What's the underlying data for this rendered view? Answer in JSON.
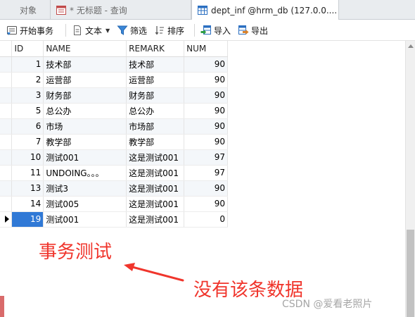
{
  "tabs": [
    {
      "label": "对象",
      "active": false
    },
    {
      "label": "* 无标题 - 查询",
      "active": false
    },
    {
      "label": "dept_inf @hrm_db (127.0.0....",
      "active": true
    }
  ],
  "toolbar": {
    "begin_transaction": "开始事务",
    "text": "文本",
    "filter": "筛选",
    "sort": "排序",
    "import": "导入",
    "export": "导出"
  },
  "table": {
    "columns": [
      "ID",
      "NAME",
      "REMARK",
      "NUM"
    ],
    "rows": [
      {
        "id": "1",
        "name": "技术部",
        "remark": "技术部",
        "num": "90"
      },
      {
        "id": "2",
        "name": "运营部",
        "remark": "运营部",
        "num": "90"
      },
      {
        "id": "3",
        "name": "财务部",
        "remark": "财务部",
        "num": "90"
      },
      {
        "id": "5",
        "name": "总公办",
        "remark": "总公办",
        "num": "90"
      },
      {
        "id": "6",
        "name": "市场",
        "remark": "市场部",
        "num": "90"
      },
      {
        "id": "7",
        "name": "教学部",
        "remark": "教学部",
        "num": "90"
      },
      {
        "id": "10",
        "name": "测试001",
        "remark": "这是测试001",
        "num": "97"
      },
      {
        "id": "11",
        "name": "UNDOING。。。",
        "remark": "这是测试001",
        "num": "97"
      },
      {
        "id": "13",
        "name": "测试3",
        "remark": "这是测试001",
        "num": "90"
      },
      {
        "id": "14",
        "name": "测试005",
        "remark": "这是测试001",
        "num": "90"
      },
      {
        "id": "19",
        "name": "测试001",
        "remark": "这是测试001",
        "num": "0"
      }
    ],
    "selected_row_index": 10
  },
  "annotations": {
    "label1": "事务测试",
    "label2": "没有该条数据"
  },
  "watermark": "CSDN @爱看老照片",
  "colors": {
    "annotation": "#f0352c",
    "selection": "#3079d6"
  }
}
